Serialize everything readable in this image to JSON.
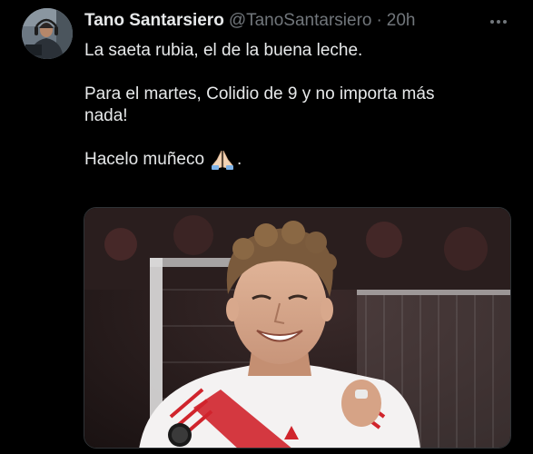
{
  "tweet": {
    "author": {
      "display_name": "Tano Santarsiero",
      "handle": "@TanoSantarsiero",
      "avatar_icon": "profile-photo"
    },
    "separator": "·",
    "timestamp": "20h",
    "more_icon": "ellipsis-icon",
    "text": {
      "line1": "La saeta rubia, el de la buena leche.",
      "line2a": "Para el martes, Colidio de 9 y no importa más",
      "line2b": "nada!",
      "line3": "Hacelo muñeco",
      "line3_end": ".",
      "emoji": "praying-hands"
    },
    "media": {
      "type": "photo",
      "subject": "football-player-smiling-in-white-red-jersey"
    }
  },
  "colors": {
    "background": "#000000",
    "text_primary": "#e7e9ea",
    "text_secondary": "#71767b",
    "border": "#2f3336"
  }
}
